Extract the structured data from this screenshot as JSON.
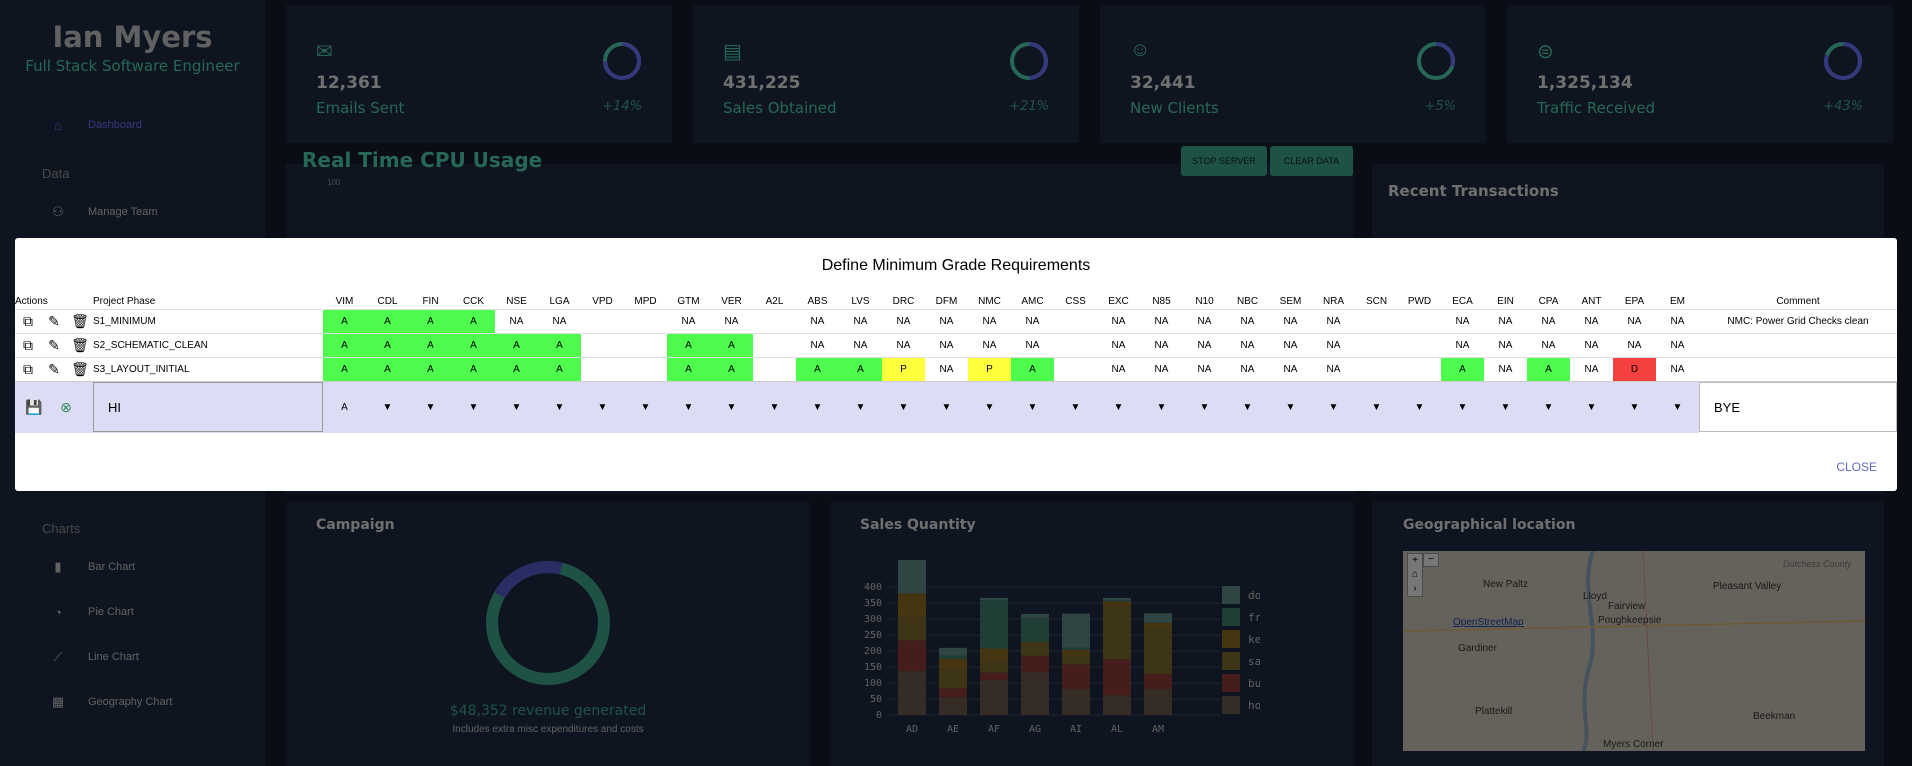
{
  "sidebar": {
    "name": "Ian Myers",
    "role": "Full Stack Software Engineer",
    "items": [
      {
        "label": "Dashboard",
        "icon": "home-icon"
      },
      {
        "label": "Manage Team",
        "icon": "team-icon"
      },
      {
        "label": "Bar Chart",
        "icon": "bar-chart-icon"
      },
      {
        "label": "Pie Chart",
        "icon": "pie-chart-icon"
      },
      {
        "label": "Line Chart",
        "icon": "line-chart-icon"
      },
      {
        "label": "Geography Chart",
        "icon": "map-icon"
      }
    ],
    "sections": {
      "data": "Data",
      "charts": "Charts"
    }
  },
  "stats": [
    {
      "value": "12,361",
      "label": "Emails Sent",
      "change": "+14%",
      "icon": "email-icon",
      "progress": 0.75
    },
    {
      "value": "431,225",
      "label": "Sales Obtained",
      "change": "+21%",
      "icon": "point-of-sale-icon",
      "progress": 0.5
    },
    {
      "value": "32,441",
      "label": "New Clients",
      "change": "+5%",
      "icon": "person-add-icon",
      "progress": 0.3
    },
    {
      "value": "1,325,134",
      "label": "Traffic Received",
      "change": "+43%",
      "icon": "traffic-icon",
      "progress": 0.8
    }
  ],
  "cpu": {
    "title": "Real Time CPU Usage",
    "axis_top": "100",
    "stop_label": "STOP SERVER",
    "clear_label": "CLEAR DATA"
  },
  "transactions": {
    "title": "Recent Transactions"
  },
  "campaign": {
    "title": "Campaign",
    "revenue": "$48,352 revenue generated",
    "note": "Includes extra misc expenditures and costs",
    "progress": 0.8
  },
  "sales": {
    "title": "Sales Quantity"
  },
  "geo": {
    "title": "Geographical location",
    "attribution": "OpenStreetMap",
    "places": [
      "New Paltz",
      "Lloyd",
      "Pleasant Valley",
      "Fairview",
      "Poughkeepsie",
      "Gardiner",
      "Plattekill",
      "Beekman",
      "Myers Corner",
      "Dutchess County"
    ]
  },
  "chart_data": {
    "type": "bar",
    "categories": [
      "AD",
      "AE",
      "AF",
      "AG",
      "AI",
      "AL",
      "AM"
    ],
    "ylim": [
      0,
      400
    ],
    "yticks": [
      0,
      50,
      100,
      150,
      200,
      250,
      300,
      350,
      400
    ],
    "series": [
      {
        "name": "hot dog",
        "color": "#6b5b4b",
        "values": [
          137,
          55,
          109,
          133,
          81,
          62,
          81
        ]
      },
      {
        "name": "burger",
        "color": "#8b3a37",
        "values": [
          96,
          28,
          23,
          52,
          77,
          112,
          47
        ]
      },
      {
        "name": "sandwich",
        "color": "#7a6a2a",
        "values": [
          72,
          58,
          34,
          43,
          23,
          167,
          144
        ]
      },
      {
        "name": "kebab",
        "color": "#8b6a22",
        "values": [
          75,
          35,
          42,
          1,
          23,
          14,
          16
        ]
      },
      {
        "name": "fries",
        "color": "#3e7c6c",
        "values": [
          0,
          10,
          151,
          73,
          7,
          3,
          0
        ]
      },
      {
        "name": "donut",
        "color": "#5d8a83",
        "values": [
          118,
          24,
          7,
          14,
          106,
          8,
          30
        ]
      }
    ]
  },
  "modal": {
    "title": "Define Minimum Grade Requirements",
    "headers": {
      "actions": "Actions",
      "phase": "Project Phase",
      "comment": "Comment"
    },
    "columns": [
      "VIM",
      "CDL",
      "FIN",
      "CCK",
      "NSE",
      "LGA",
      "VPD",
      "MPD",
      "GTM",
      "VER",
      "A2L",
      "ABS",
      "LVS",
      "DRC",
      "DFM",
      "NMC",
      "AMC",
      "CSS",
      "EXC",
      "N85",
      "N10",
      "NBC",
      "SEM",
      "NRA",
      "SCN",
      "PWD",
      "ECA",
      "EIN",
      "CPA",
      "ANT",
      "EPA",
      "EM"
    ],
    "rows": [
      {
        "phase": "S1_MINIMUM",
        "comment": "NMC: Power Grid Checks clean",
        "cells": [
          "A",
          "A",
          "A",
          "A",
          "NA",
          "NA",
          "",
          "",
          "NA",
          "NA",
          "",
          "NA",
          "NA",
          "NA",
          "NA",
          "NA",
          "NA",
          "",
          "NA",
          "NA",
          "NA",
          "NA",
          "NA",
          "NA",
          "",
          "",
          "NA",
          "NA",
          "NA",
          "NA",
          "NA",
          "NA"
        ]
      },
      {
        "phase": "S2_SCHEMATIC_CLEAN",
        "comment": "",
        "cells": [
          "A",
          "A",
          "A",
          "A",
          "A",
          "A",
          "",
          "",
          "A",
          "A",
          "",
          "NA",
          "NA",
          "NA",
          "NA",
          "NA",
          "NA",
          "",
          "NA",
          "NA",
          "NA",
          "NA",
          "NA",
          "NA",
          "",
          "",
          "NA",
          "NA",
          "NA",
          "NA",
          "NA",
          "NA"
        ]
      },
      {
        "phase": "S3_LAYOUT_INITIAL",
        "comment": "",
        "cells": [
          "A",
          "A",
          "A",
          "A",
          "A",
          "A",
          "",
          "",
          "A",
          "A",
          "",
          "A",
          "A",
          "P",
          "NA",
          "P",
          "A",
          "",
          "NA",
          "NA",
          "NA",
          "NA",
          "NA",
          "NA",
          "",
          "",
          "A",
          "NA",
          "A",
          "NA",
          "D",
          "NA"
        ]
      }
    ],
    "edit": {
      "phase_value": "HI",
      "first_value": "A",
      "comment_value": "BYE"
    },
    "close_label": "CLOSE"
  }
}
